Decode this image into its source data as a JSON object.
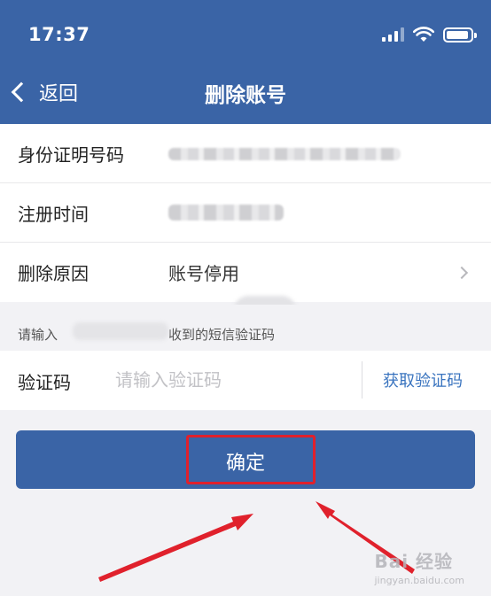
{
  "status_bar": {
    "time": "17:37"
  },
  "nav": {
    "back_label": "返回",
    "title": "删除账号"
  },
  "rows": [
    {
      "label": "身份证明号码"
    },
    {
      "label": "注册时间"
    },
    {
      "label": "删除原因",
      "value": "账号停用"
    }
  ],
  "hint": {
    "prefix": "请输入",
    "suffix": "收到的短信验证码"
  },
  "code_field": {
    "label": "验证码",
    "placeholder": "请输入验证码",
    "get_code_label": "获取验证码"
  },
  "confirm_button": {
    "label": "确定"
  },
  "watermark": {
    "main": "Bai 经验",
    "sub": "jingyan.baidu.com"
  },
  "colors": {
    "primary": "#3a64a6",
    "link": "#3a74bf",
    "highlight": "#e0212c"
  }
}
